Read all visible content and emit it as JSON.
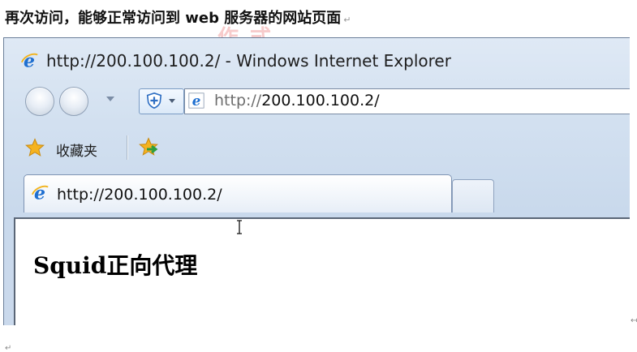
{
  "document": {
    "caption": "再次访问，能够正常访问到 web 服务器的网站页面",
    "paragraph_mark": "↵",
    "watermark": "作式",
    "stray_mark_right": "↤",
    "stray_mark_bottom": "↵"
  },
  "browser": {
    "window_title": "http://200.100.100.2/ - Windows Internet Explorer",
    "address": {
      "scheme": "http://",
      "host": "200.100.100.2/"
    },
    "favorites": {
      "label": "收藏夹"
    },
    "tabs": [
      {
        "label": "http://200.100.100.2/",
        "active": true
      }
    ],
    "page": {
      "heading": "Squid正向代理"
    }
  },
  "icons": {
    "window_logo": "ie-logo-icon",
    "back": "back-button",
    "forward": "forward-button",
    "compat": "compatibility-view-icon",
    "favorites": "favorites-star-icon",
    "add_favorite": "add-favorite-icon",
    "cursor": "text-cursor-icon"
  },
  "colors": {
    "chrome_background": "#d2e0f0",
    "ie_logo_blue": "#1f6fd0",
    "favorite_star": "#f5b320",
    "add_favorite_green": "#2e9e3e"
  }
}
